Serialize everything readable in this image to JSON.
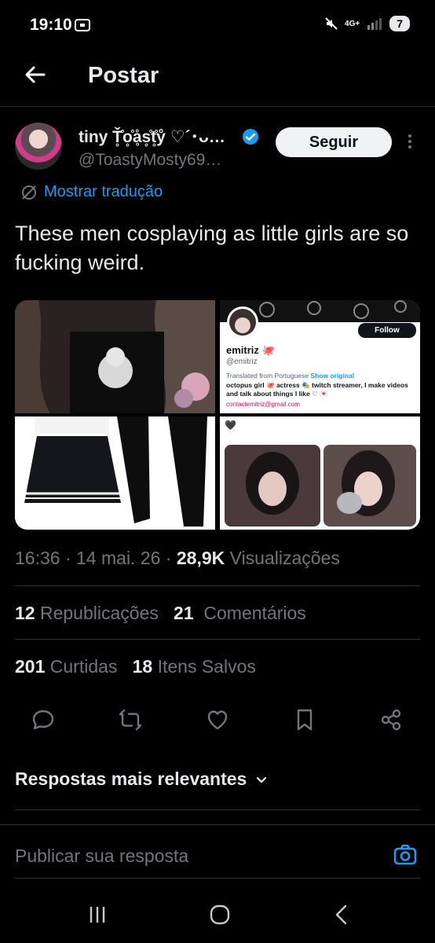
{
  "status": {
    "time": "19:10",
    "network": "4G+",
    "battery": "7"
  },
  "header": {
    "title": "Postar"
  },
  "author": {
    "name": "tiny Ť̥̊o̥̊ḁ̊s̥̊t̥̊ẙ ♡´･ᴗ…",
    "handle": "@ToastyMosty69…",
    "follow_label": "Seguir"
  },
  "tweet": {
    "translate_label": "Mostrar tradução",
    "text": "These men cosplaying as little girls are so fucking weird."
  },
  "embedded_profile": {
    "name": "emitriz 🐙",
    "handle": "@emitriz",
    "follow_label": "Follow",
    "translated_note": "Translated from Portuguese",
    "show_original": "Show original",
    "bio": "octopus girl 🐙 actress 🎭 twitch streamer, I make videos and talk about things I like ♡ 💌",
    "email": "contactemitriz@gmail.com",
    "heart": "🖤"
  },
  "meta": {
    "time": "16:36",
    "date": "14 mai. 26",
    "views_count": "28,9K",
    "views_label": "Visualizações"
  },
  "stats": {
    "reposts_count": "12",
    "reposts_label": "Republicações",
    "comments_count": "21",
    "comments_label": "Comentários",
    "likes_count": "201",
    "likes_label": "Curtidas",
    "saves_count": "18",
    "saves_label": "Itens Salvos"
  },
  "replies": {
    "header": "Respostas mais relevantes",
    "placeholder": "Publicar sua resposta"
  },
  "colors": {
    "accent": "#1d9bf0",
    "background": "#000000",
    "muted": "#71767b"
  }
}
